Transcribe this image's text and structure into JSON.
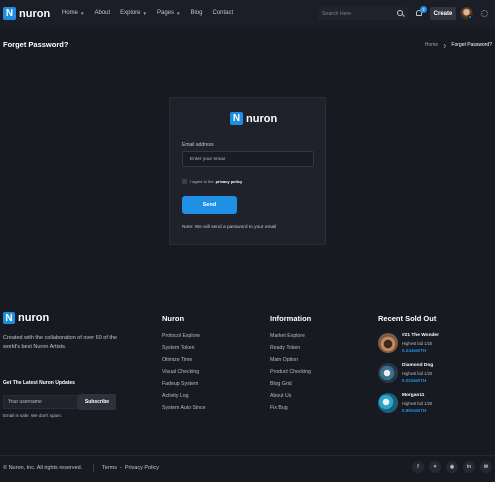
{
  "brand": {
    "logo_letter": "N",
    "name": "nuron"
  },
  "nav": [
    {
      "label": "Home",
      "has_dropdown": true
    },
    {
      "label": "About",
      "has_dropdown": false
    },
    {
      "label": "Explore",
      "has_dropdown": true
    },
    {
      "label": "Pages",
      "has_dropdown": true
    },
    {
      "label": "Blog",
      "has_dropdown": false
    },
    {
      "label": "Contact",
      "has_dropdown": false
    }
  ],
  "header": {
    "search_placeholder": "Search Here",
    "notification_count": "2",
    "create_label": "Create"
  },
  "page": {
    "title": "Forget Password?",
    "breadcrumb": [
      "Home",
      "Forget Password?"
    ]
  },
  "form": {
    "email_label": "Email address",
    "email_placeholder": "Enter your email",
    "agree_text": "I agree to the",
    "agree_link": "privacy policy",
    "send_label": "Send",
    "note": "Note: We will send a password to your email"
  },
  "footer": {
    "tagline": "Created with the collaboration of over 60 of the world's best Nuron Artists.",
    "updates_title": "Get The Latest Nuron Updates",
    "subscribe_placeholder": "Your username",
    "subscribe_label": "Subscribe",
    "safe_text": "Email is safe. We don't spam.",
    "columns": [
      {
        "title": "Nuron",
        "links": [
          "Protocol Explore",
          "System Token",
          "Otimize Time",
          "Visual Checking",
          "Fadeup System",
          "Activity Log",
          "System Auto Since"
        ]
      },
      {
        "title": "Information",
        "links": [
          "Market Explore",
          "Ready Token",
          "Main Option",
          "Product Checking",
          "Blog Grid",
          "About Us",
          "Fix Bug"
        ]
      }
    ],
    "recent_title": "Recent Sold Out",
    "recent": [
      {
        "name": "#21 The Wonder",
        "bid": "Highest bid 1/20",
        "price": "0.244wETH",
        "color": "#c98a5a"
      },
      {
        "name": "Diamond Dog",
        "bid": "Highest bid 1/20",
        "price": "0.022wETH",
        "color": "#3c6f8a"
      },
      {
        "name": "Morgan11",
        "bid": "Highest bid 1/20",
        "price": "0.892wETH",
        "color": "#2aa6c9"
      }
    ],
    "copyright": "© Nuron, Inc. All rights reserved.",
    "legal": [
      "Terms",
      "Privacy Policy"
    ],
    "socials": [
      "facebook-icon",
      "twitter-icon",
      "instagram-icon",
      "linkedin-icon",
      "mail-icon"
    ]
  },
  "colors": {
    "accent": "#1e90e6",
    "background": "#171a21",
    "card": "#1f222a"
  }
}
